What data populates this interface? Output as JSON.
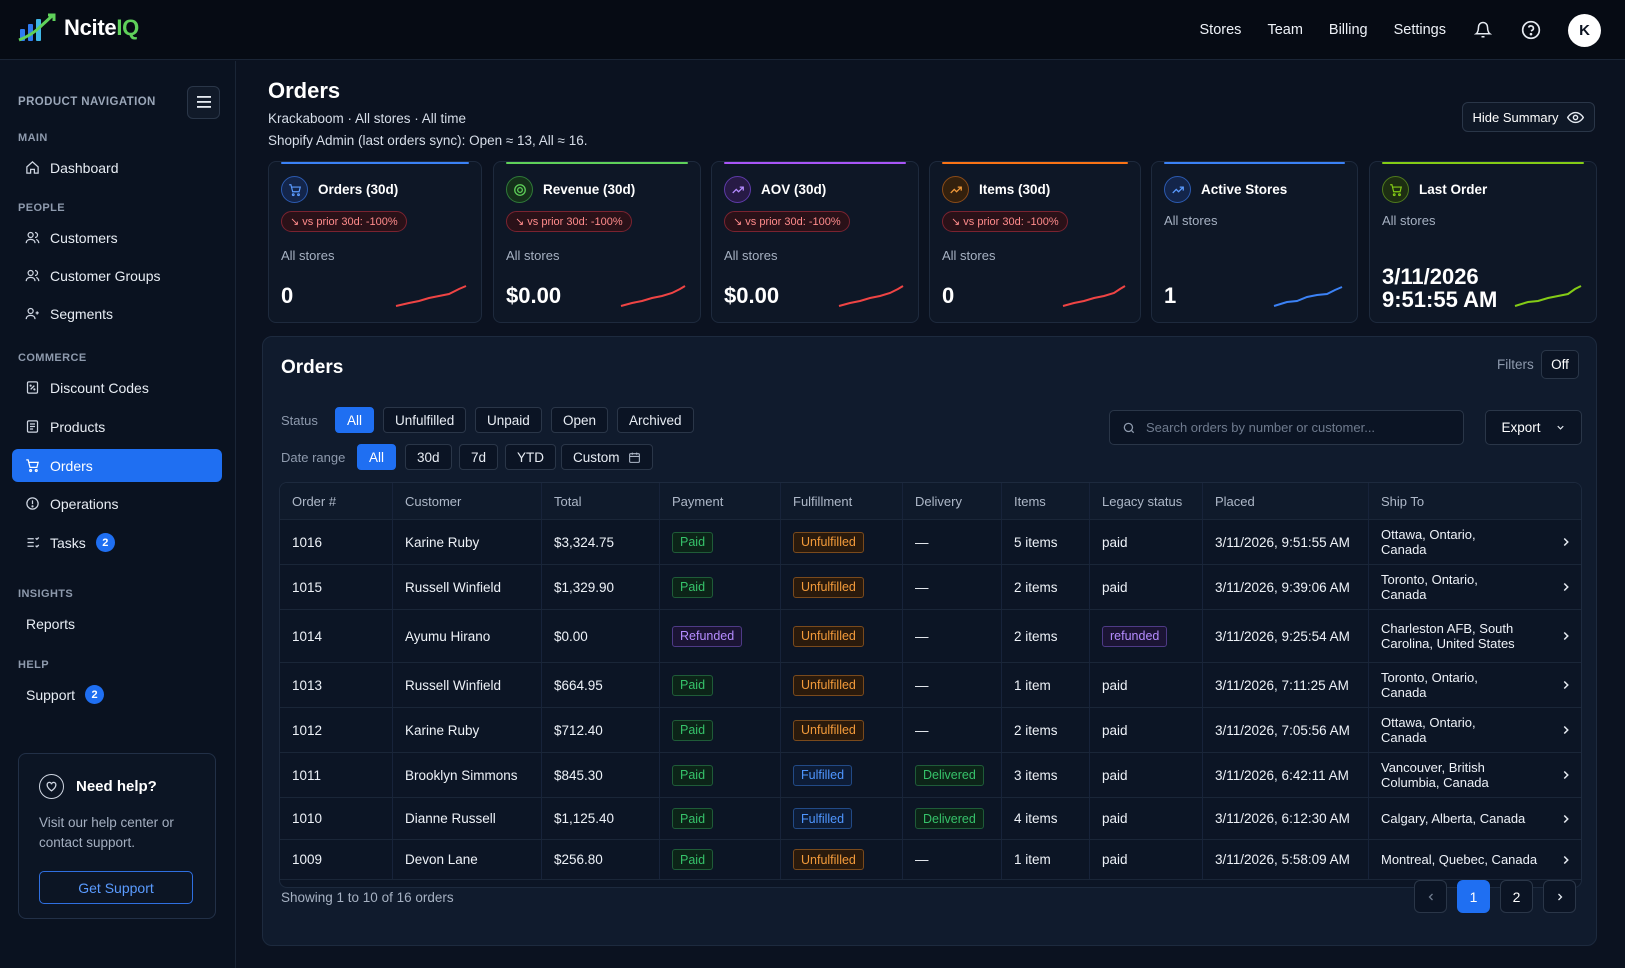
{
  "app": {
    "logo_main": "Ncite",
    "logo_accent": "IQ"
  },
  "topnav": {
    "links": [
      "Stores",
      "Team",
      "Billing",
      "Settings"
    ],
    "avatar": "K"
  },
  "sidebar": {
    "heading": "PRODUCT NAVIGATION",
    "sections": {
      "main": "MAIN",
      "people": "PEOPLE",
      "commerce": "COMMERCE",
      "insights": "INSIGHTS",
      "help": "HELP"
    },
    "items": {
      "dashboard": "Dashboard",
      "customers": "Customers",
      "customer_groups": "Customer Groups",
      "segments": "Segments",
      "discount_codes": "Discount Codes",
      "products": "Products",
      "orders": "Orders",
      "operations": "Operations",
      "tasks": "Tasks",
      "tasks_badge": "2",
      "reports": "Reports",
      "support": "Support",
      "support_badge": "2"
    },
    "help_card": {
      "title": "Need help?",
      "desc": "Visit our help center or contact support.",
      "button": "Get Support"
    }
  },
  "header": {
    "title": "Orders",
    "subtitle": "Krackaboom · All stores · All time",
    "sync": "Shopify Admin (last orders sync): Open ≈ 13, All ≈ 16.",
    "hide_summary": "Hide Summary"
  },
  "kpis": [
    {
      "title": "Orders (30d)",
      "delta": "↘ vs prior 30d: -100%",
      "sub": "All stores",
      "value": "0",
      "color": "#3b82f6"
    },
    {
      "title": "Revenue (30d)",
      "delta": "↘ vs prior 30d: -100%",
      "sub": "All stores",
      "value": "$0.00",
      "color": "#5fd15a"
    },
    {
      "title": "AOV (30d)",
      "delta": "↘ vs prior 30d: -100%",
      "sub": "All stores",
      "value": "$0.00",
      "color": "#a855f7"
    },
    {
      "title": "Items (30d)",
      "delta": "↘ vs prior 30d: -100%",
      "sub": "All stores",
      "value": "0",
      "color": "#f97316"
    },
    {
      "title": "Active Stores",
      "sub": "All stores",
      "value": "1",
      "color": "#3b82f6"
    },
    {
      "title": "Last Order",
      "sub": "All stores",
      "value_line1": "3/11/2026",
      "value_line2": "9:51:55 AM",
      "color": "#84cc16"
    }
  ],
  "orders_panel": {
    "title": "Orders",
    "filters_label": "Filters",
    "filters_state": "Off",
    "status_label": "Status",
    "status_chips": [
      "All",
      "Unfulfilled",
      "Unpaid",
      "Open",
      "Archived"
    ],
    "date_label": "Date range",
    "date_chips": [
      "All",
      "30d",
      "7d",
      "YTD",
      "Custom"
    ],
    "search_placeholder": "Search orders by number or customer...",
    "export": "Export",
    "columns": [
      "Order #",
      "Customer",
      "Total",
      "Payment",
      "Fulfillment",
      "Delivery",
      "Items",
      "Legacy status",
      "Placed",
      "Ship To"
    ],
    "rows": [
      {
        "order": "1016",
        "customer": "Karine Ruby",
        "total": "$3,324.75",
        "payment": "Paid",
        "fulfillment": "Unfulfilled",
        "delivery": "—",
        "items": "5 items",
        "legacy": "paid",
        "placed": "3/11/2026, 9:51:55 AM",
        "ship1": "Ottawa, Ontario,",
        "ship2": "Canada"
      },
      {
        "order": "1015",
        "customer": "Russell Winfield",
        "total": "$1,329.90",
        "payment": "Paid",
        "fulfillment": "Unfulfilled",
        "delivery": "—",
        "items": "2 items",
        "legacy": "paid",
        "placed": "3/11/2026, 9:39:06 AM",
        "ship1": "Toronto, Ontario,",
        "ship2": "Canada"
      },
      {
        "order": "1014",
        "customer": "Ayumu Hirano",
        "total": "$0.00",
        "payment": "Refunded",
        "fulfillment": "Unfulfilled",
        "delivery": "—",
        "items": "2 items",
        "legacy": "refunded",
        "placed": "3/11/2026, 9:25:54 AM",
        "ship1": "Charleston AFB, South",
        "ship2": "Carolina, United States"
      },
      {
        "order": "1013",
        "customer": "Russell Winfield",
        "total": "$664.95",
        "payment": "Paid",
        "fulfillment": "Unfulfilled",
        "delivery": "—",
        "items": "1 item",
        "legacy": "paid",
        "placed": "3/11/2026, 7:11:25 AM",
        "ship1": "Toronto, Ontario,",
        "ship2": "Canada"
      },
      {
        "order": "1012",
        "customer": "Karine Ruby",
        "total": "$712.40",
        "payment": "Paid",
        "fulfillment": "Unfulfilled",
        "delivery": "—",
        "items": "2 items",
        "legacy": "paid",
        "placed": "3/11/2026, 7:05:56 AM",
        "ship1": "Ottawa, Ontario,",
        "ship2": "Canada"
      },
      {
        "order": "1011",
        "customer": "Brooklyn Simmons",
        "total": "$845.30",
        "payment": "Paid",
        "fulfillment": "Fulfilled",
        "delivery": "Delivered",
        "items": "3 items",
        "legacy": "paid",
        "placed": "3/11/2026, 6:42:11 AM",
        "ship1": "Vancouver, British",
        "ship2": "Columbia, Canada"
      },
      {
        "order": "1010",
        "customer": "Dianne Russell",
        "total": "$1,125.40",
        "payment": "Paid",
        "fulfillment": "Fulfilled",
        "delivery": "Delivered",
        "items": "4 items",
        "legacy": "paid",
        "placed": "3/11/2026, 6:12:30 AM",
        "ship1": "Calgary, Alberta, Canada",
        "ship2": ""
      },
      {
        "order": "1009",
        "customer": "Devon Lane",
        "total": "$256.80",
        "payment": "Paid",
        "fulfillment": "Unfulfilled",
        "delivery": "—",
        "items": "1 item",
        "legacy": "paid",
        "placed": "3/11/2026, 5:58:09 AM",
        "ship1": "Montreal, Quebec, Canada",
        "ship2": ""
      }
    ],
    "showing": "Showing 1 to 10 of 16 orders",
    "pages": [
      "1",
      "2"
    ],
    "current_page": "1"
  }
}
